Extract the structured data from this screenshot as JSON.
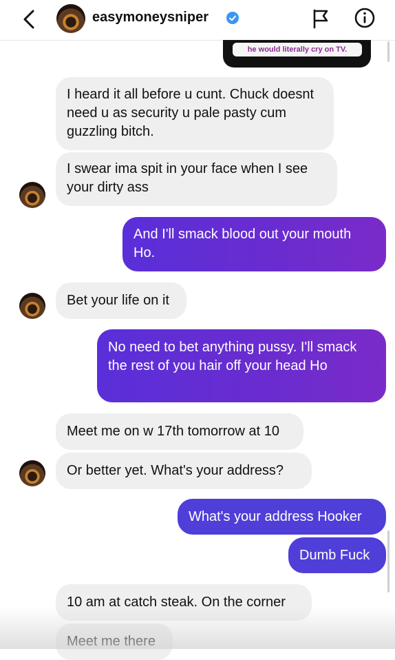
{
  "header": {
    "username": "easymoneysniper",
    "back_icon": "chevron-left-icon",
    "verified_icon": "verified-badge-icon",
    "flag_icon": "flag-icon",
    "info_icon": "info-icon"
  },
  "story_reply": {
    "text": "he would literally cry on TV."
  },
  "messages": [
    {
      "side": "in",
      "text": "I heard it all before u cunt. Chuck doesnt need u as security u pale pasty cum guzzling bitch."
    },
    {
      "side": "in",
      "text": "I swear ima spit in your face when I see your dirty ass"
    },
    {
      "side": "out",
      "text": "And I'll smack blood out your mouth Ho."
    },
    {
      "side": "in",
      "text": "Bet your life on it"
    },
    {
      "side": "out",
      "text": "No need to bet anything pussy. I'll smack the rest of you hair off your head Ho"
    },
    {
      "side": "in",
      "text": "Meet me on w 17th tomorrow at 10"
    },
    {
      "side": "in",
      "text": "Or better yet. What's your address?"
    },
    {
      "side": "out",
      "text": "What's your address Hooker"
    },
    {
      "side": "out",
      "text": "Dumb Fuck"
    },
    {
      "side": "in",
      "text": "10 am at catch steak. On the corner"
    },
    {
      "side": "in",
      "text": "Meet me there"
    }
  ],
  "colors": {
    "incoming_bubble": "#efefef",
    "outgoing_bubble": "#5a2fd9",
    "outgoing_bubble_blue": "#4f3fd8",
    "verified": "#3897f0"
  }
}
